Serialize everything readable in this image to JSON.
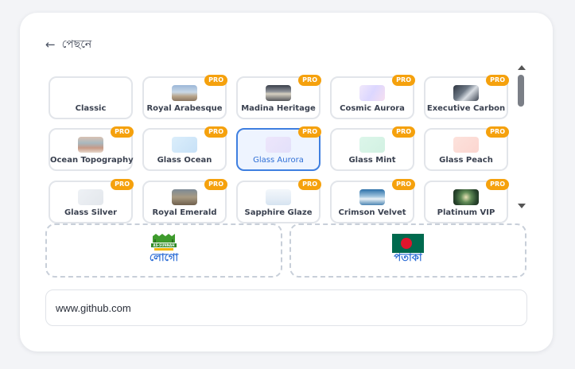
{
  "nav": {
    "back_label": "পেছনে",
    "back_icon": "arrow-left-icon"
  },
  "themes": [
    {
      "name": "Classic",
      "pro": "",
      "thumb": "classic"
    },
    {
      "name": "Royal Arabesque",
      "pro": "PRO",
      "thumb": "royal-arabesque"
    },
    {
      "name": "Madina Heritage",
      "pro": "PRO",
      "thumb": "madina-heritage"
    },
    {
      "name": "Cosmic Aurora",
      "pro": "PRO",
      "thumb": "cosmic-aurora"
    },
    {
      "name": "Executive Carbon",
      "pro": "PRO",
      "thumb": "executive-carbon"
    },
    {
      "name": "Ocean Topography",
      "pro": "PRO",
      "thumb": "ocean-topography"
    },
    {
      "name": "Glass Ocean",
      "pro": "PRO",
      "thumb": "glass-ocean"
    },
    {
      "name": "Glass Aurora",
      "pro": "PRO",
      "thumb": "glass-aurora",
      "selected": true
    },
    {
      "name": "Glass Mint",
      "pro": "PRO",
      "thumb": "glass-mint"
    },
    {
      "name": "Glass Peach",
      "pro": "PRO",
      "thumb": "glass-peach"
    },
    {
      "name": "Glass Silver",
      "pro": "PRO",
      "thumb": "glass-silver"
    },
    {
      "name": "Royal Emerald",
      "pro": "PRO",
      "thumb": "royal-emerald"
    },
    {
      "name": "Sapphire Glaze",
      "pro": "PRO",
      "thumb": "sapphire-glaze"
    },
    {
      "name": "Crimson Velvet",
      "pro": "PRO",
      "thumb": "crimson-velvet"
    },
    {
      "name": "Platinum VIP",
      "pro": "PRO",
      "thumb": "platinum-vip"
    }
  ],
  "uploads": {
    "logo": {
      "label": "লোগো",
      "logo_text": "AS-SUNNAH",
      "icon": "logo-image"
    },
    "flag": {
      "label": "পতাকা",
      "icon": "bangladesh-flag-icon"
    }
  },
  "url_field": {
    "value": "www.github.com"
  },
  "colors": {
    "accent": "#2f6fd6",
    "pro_badge": "#f5a10d",
    "flag_green": "#006a4e",
    "flag_red": "#e0152c"
  }
}
